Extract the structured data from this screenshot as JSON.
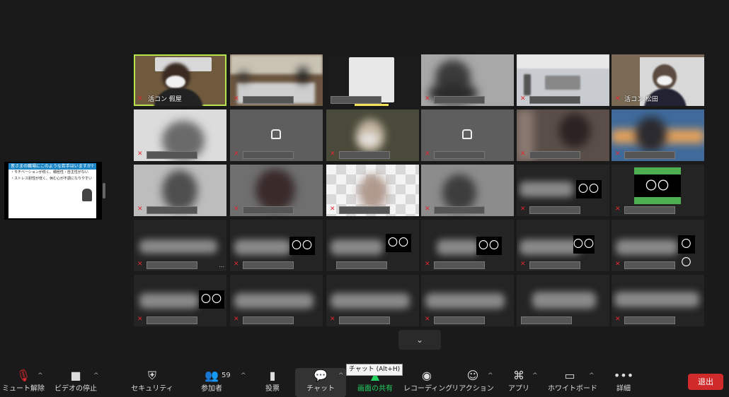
{
  "participants": {
    "names": {
      "host": "活コン 假屋",
      "guest": "活コン 松田"
    },
    "count": "59",
    "video_off_glyph": "〇〇"
  },
  "shared_screen": {
    "slide_title": "皆さまの職場にこのような若手はいますか?",
    "bullets": [
      "・モチベーションが低く、積極性・自主性がない",
      "・ストレス耐性が低く、休む心が不調になりやすい"
    ]
  },
  "toolbar": {
    "mute": "ミュート解除",
    "video": "ビデオの停止",
    "security": "セキュリティ",
    "participants": "参加者",
    "poll": "投票",
    "chat": "チャット",
    "share": "画面の共有",
    "record": "レコーディング",
    "reactions": "リアクション",
    "apps": "アプリ",
    "whiteboard": "ホワイトボード",
    "more": "詳細",
    "leave": "退出"
  },
  "tooltip": "チャット (Alt+H)",
  "colors": {
    "active_speaker": "#b6e34e",
    "share_green": "#23d160",
    "leave_red": "#d12a2a",
    "muted_red": "#e0282f"
  },
  "icons": {
    "mic_off": "mic-off-icon",
    "video": "video-icon",
    "shield": "shield-icon",
    "people": "people-icon",
    "poll": "poll-icon",
    "chat": "chat-icon",
    "share": "share-screen-icon",
    "record": "record-icon",
    "reactions": "smile-plus-icon",
    "apps": "apps-icon",
    "whiteboard": "whiteboard-icon",
    "more": "more-icon",
    "expand": "chevron-down-icon"
  }
}
